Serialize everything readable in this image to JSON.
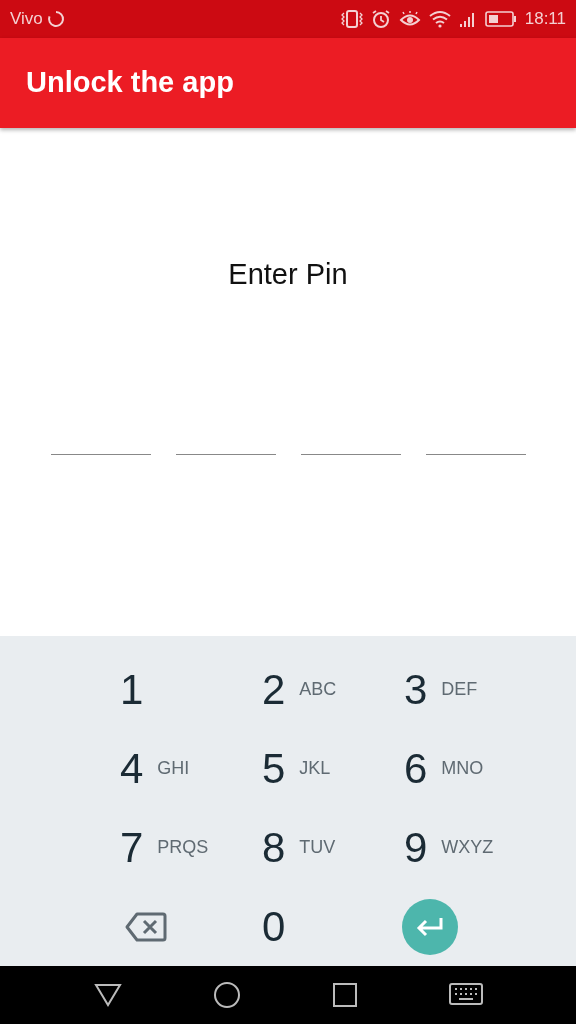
{
  "status_bar": {
    "carrier": "Vivo",
    "time": "18:11"
  },
  "app_bar": {
    "title": "Unlock the app"
  },
  "prompt": "Enter Pin",
  "pin_fields": [
    {
      "kind": "digit"
    },
    {
      "kind": "digit"
    },
    {
      "kind": "digit"
    },
    {
      "kind": "digit"
    }
  ],
  "keypad": [
    {
      "kind": "digit",
      "label": "1"
    },
    {
      "kind": "digit",
      "label": "2",
      "letters": "ABC"
    },
    {
      "kind": "digit",
      "label": "3",
      "letters": "DEF"
    },
    {
      "kind": "digit",
      "label": "4",
      "letters": "GHI"
    },
    {
      "kind": "digit",
      "label": "5",
      "letters": "JKL"
    },
    {
      "kind": "digit",
      "label": "6",
      "letters": "MNO"
    },
    {
      "kind": "digit",
      "label": "7",
      "letters": "PRQS"
    },
    {
      "kind": "digit",
      "label": "8",
      "letters": "TUV"
    },
    {
      "kind": "digit",
      "label": "9",
      "letters": "WXYZ"
    },
    {
      "kind": "backspace"
    },
    {
      "kind": "digit",
      "label": "0"
    },
    {
      "kind": "enter"
    }
  ]
}
